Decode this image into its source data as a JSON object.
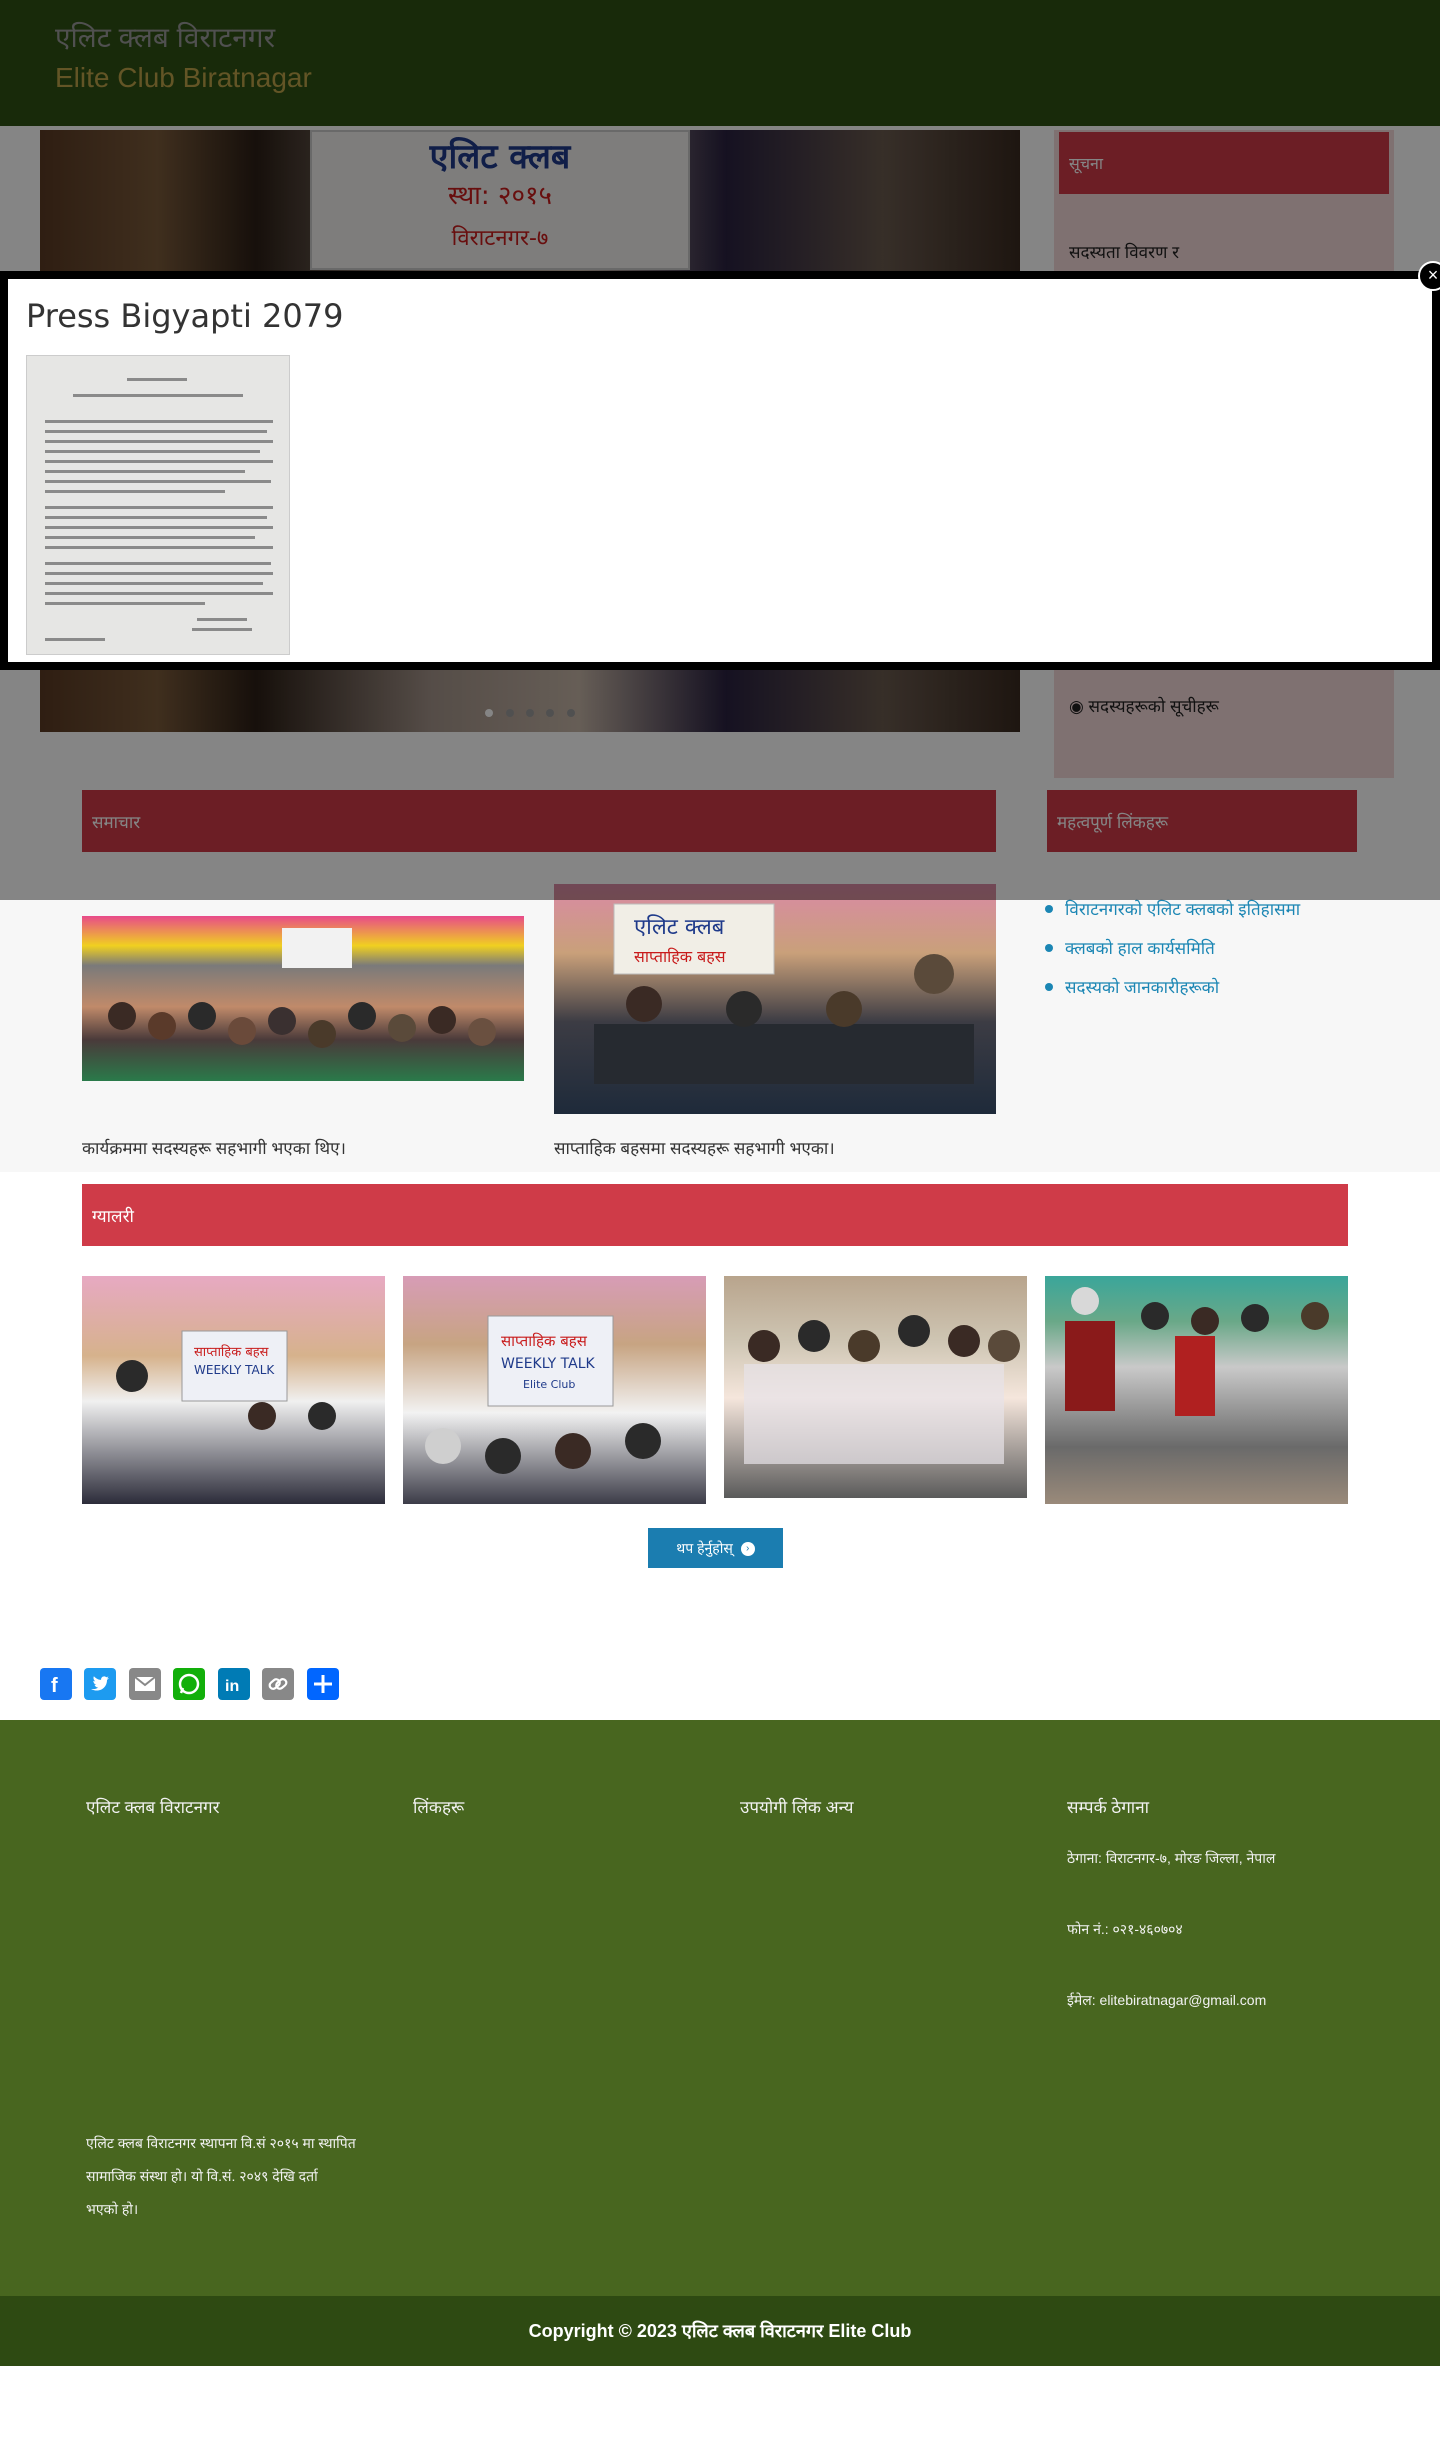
{
  "header": {
    "title_np": "एलिट क्लब विराटनगर",
    "title_en": "Elite Club Biratnagar"
  },
  "hero": {
    "banner_line1": "एलिट क्लब",
    "banner_line2": "स्था: २०१५",
    "banner_line3": "विराटनगर-७"
  },
  "notice": {
    "heading": "सूचना",
    "items": [
      "सदस्यता विवरण र",
      "◉ सदस्यहरूको सूचीहरू"
    ]
  },
  "news": {
    "heading": "समाचार",
    "items": [
      {
        "title": "कार्यक्रममा सदस्यहरू सहभागी भएका थिए।"
      },
      {
        "title": "साप्ताहिक बहसमा सदस्यहरू सहभागी भएका।"
      }
    ]
  },
  "quick_links": {
    "heading": "महत्वपूर्ण लिंकहरू",
    "items": [
      "विराटनगरको एलिट क्लबको इतिहासमा",
      "क्लबको हाल कार्यसमिति",
      "सदस्यको जानकारीहरूको"
    ]
  },
  "gallery": {
    "heading": "ग्यालरी",
    "images": [
      {
        "caption": "साप्ताहिक बहस WEEKLY TALK Elite Club"
      },
      {
        "caption": "साप्ताहिक बहस WEEKLY TALK Elite Club"
      },
      {
        "caption": ""
      },
      {
        "caption": ""
      }
    ],
    "more_label": "थप हेर्नुहोस्"
  },
  "share": {
    "buttons": [
      {
        "name": "facebook",
        "color": "#1877f2"
      },
      {
        "name": "twitter",
        "color": "#1d9bf0"
      },
      {
        "name": "email",
        "color": "#888888"
      },
      {
        "name": "whatsapp",
        "color": "#12af0a"
      },
      {
        "name": "linkedin",
        "color": "#007bb5"
      },
      {
        "name": "copy-link",
        "color": "#888888"
      },
      {
        "name": "share",
        "color": "#0166ff"
      }
    ]
  },
  "footer": {
    "col1_title": "एलिट क्लब विराटनगर",
    "col2_title": "लिंकहरू",
    "col3_title": "उपयोगी लिंक अन्य",
    "col4_title": "सम्पर्क ठेगाना",
    "address": "ठेगाना: विराटनगर-७, मोरङ जिल्ला, नेपाल",
    "phone": "फोन नं.: ०२१-४६०७०४",
    "email_label": "ईमेल:",
    "email": "elitebiratnagar@gmail.com",
    "about_line1": "एलिट क्लब विराटनगर स्थापना वि.सं २०१५ मा स्थापित",
    "about_line2": "सामाजिक संस्था हो। यो वि.सं. २०४९ देखि दर्ता",
    "about_line3": "भएको हो।",
    "copyright": "Copyright © 2023 एलिट क्लब विराटनगर Elite Club"
  },
  "modal": {
    "title": "Press Bigyapti 2079",
    "close_label": "×"
  },
  "colors": {
    "header_bg": "#2f5215",
    "section_red": "#cf3b48",
    "link_blue": "#1b86b4",
    "footer_bg": "#48661f",
    "bottom_bar": "#2e4a12"
  }
}
